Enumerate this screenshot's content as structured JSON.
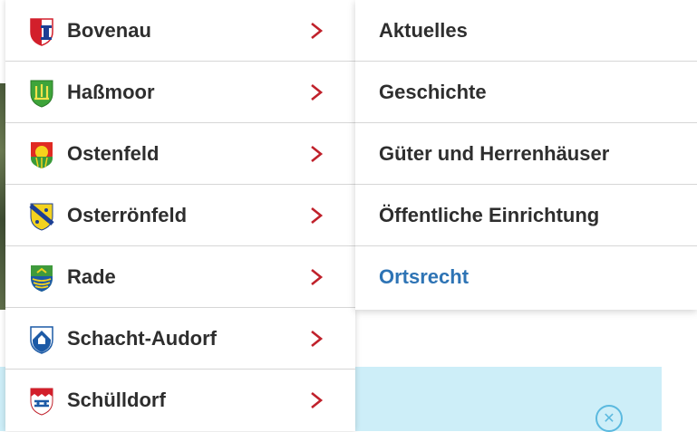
{
  "left_menu": {
    "items": [
      {
        "label": "Bovenau",
        "icon": "bovenau-crest-icon"
      },
      {
        "label": "Haßmoor",
        "icon": "hassmoor-crest-icon"
      },
      {
        "label": "Ostenfeld",
        "icon": "ostenfeld-crest-icon"
      },
      {
        "label": "Osterrönfeld",
        "icon": "osterroenfeld-crest-icon"
      },
      {
        "label": "Rade",
        "icon": "rade-crest-icon"
      },
      {
        "label": "Schacht-Audorf",
        "icon": "schacht-audorf-crest-icon"
      },
      {
        "label": "Schülldorf",
        "icon": "schuelldorf-crest-icon"
      }
    ],
    "chevron_icon": "chevron-right-icon",
    "chevron_color": "#c0212b"
  },
  "right_menu": {
    "items": [
      {
        "label": "Aktuelles"
      },
      {
        "label": "Geschichte"
      },
      {
        "label": "Güter und Herrenhäuser"
      },
      {
        "label": "Öffentliche Einrichtung"
      },
      {
        "label": "Ortsrecht"
      }
    ],
    "active_color": "#2e74b5"
  },
  "background": {
    "panel_color": "#cdeef8",
    "close_icon": "close-circle-icon",
    "close_symbol": "✕"
  }
}
